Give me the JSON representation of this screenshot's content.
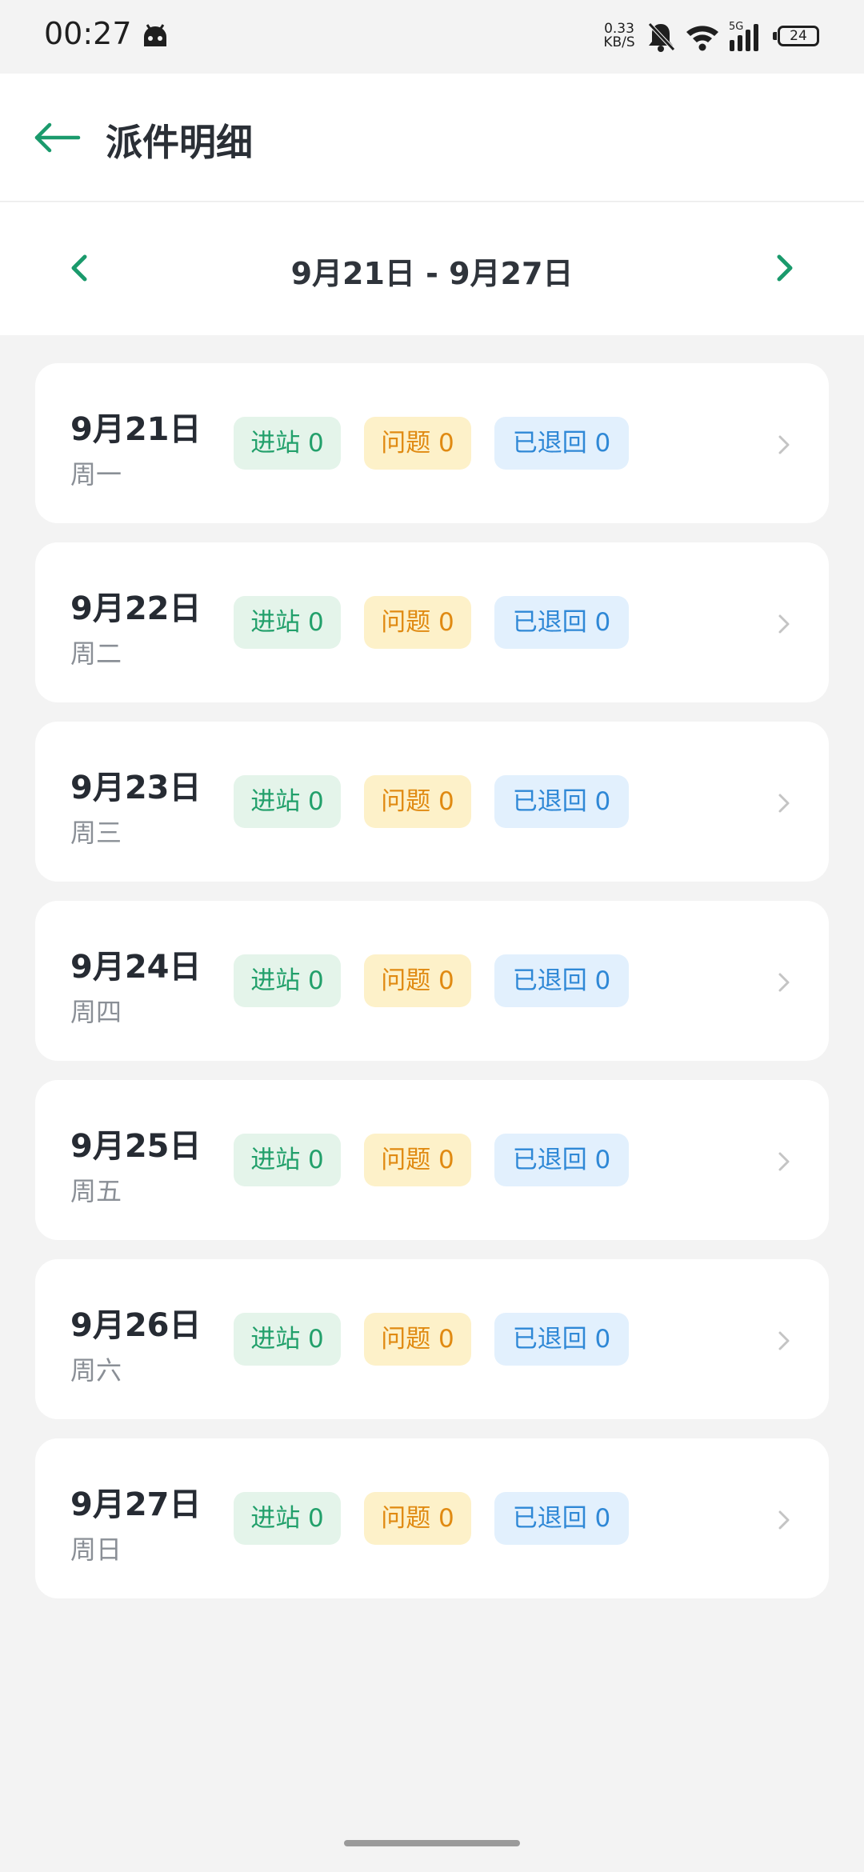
{
  "status_bar": {
    "time": "00:27",
    "net_speed_value": "0.33",
    "net_speed_unit": "KB/S",
    "network_type": "5G",
    "battery": "24",
    "icons": [
      "android-icon",
      "mute-bell-icon",
      "wifi-icon",
      "signal-icon",
      "battery-icon"
    ]
  },
  "header": {
    "title": "派件明细",
    "back_icon": "back-arrow-icon"
  },
  "week_selector": {
    "range": "9月21日 - 9月27日",
    "prev_icon": "chevron-left-icon",
    "next_icon": "chevron-right-icon"
  },
  "days": [
    {
      "date": "9月21日",
      "weekday": "周一",
      "in_station": "进站 0",
      "issue": "问题 0",
      "returned": "已退回 0"
    },
    {
      "date": "9月22日",
      "weekday": "周二",
      "in_station": "进站 0",
      "issue": "问题 0",
      "returned": "已退回 0"
    },
    {
      "date": "9月23日",
      "weekday": "周三",
      "in_station": "进站 0",
      "issue": "问题 0",
      "returned": "已退回 0"
    },
    {
      "date": "9月24日",
      "weekday": "周四",
      "in_station": "进站 0",
      "issue": "问题 0",
      "returned": "已退回 0"
    },
    {
      "date": "9月25日",
      "weekday": "周五",
      "in_station": "进站 0",
      "issue": "问题 0",
      "returned": "已退回 0"
    },
    {
      "date": "9月26日",
      "weekday": "周六",
      "in_station": "进站 0",
      "issue": "问题 0",
      "returned": "已退回 0"
    },
    {
      "date": "9月27日",
      "weekday": "周日",
      "in_station": "进站 0",
      "issue": "问题 0",
      "returned": "已退回 0"
    }
  ],
  "colors": {
    "accent": "#1a9a6c",
    "tag_in_bg": "#e4f4ea",
    "tag_in_text": "#22a06b",
    "tag_issue_bg": "#fdf1c9",
    "tag_issue_text": "#e08a12",
    "tag_return_bg": "#e2f0fd",
    "tag_return_text": "#2f88d6"
  }
}
